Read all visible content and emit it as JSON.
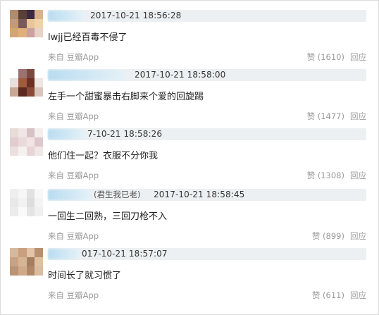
{
  "comments": [
    {
      "name_suffix": "",
      "date": "2017-10-21 18:56:28",
      "text": "lwjj已经百毒不侵了",
      "source": "来自 豆瓣App",
      "like_label": "赞 (1610)",
      "reply_label": "回应",
      "avatar_colors": [
        "#b08c6e",
        "#5a4038",
        "#3c2a40",
        "#d9b28c",
        "#c69a78",
        "#7a5a58",
        "#e8c59a",
        "#f0d2a8",
        "#d4a572",
        "#e0b07a",
        "#caa0a0",
        "#e8d2c6"
      ]
    },
    {
      "name_suffix": "",
      "date": "2017-10-21 18:58:00",
      "text": "左手一个甜蜜暴击右脚来个爱的回旋踢",
      "source": "来自 豆瓣App",
      "like_label": "赞 (1477)",
      "reply_label": "回应",
      "avatar_colors": [
        "#ffffff",
        "#9c7270",
        "#7a4a40",
        "#ffffff",
        "#e8e0dc",
        "#a05a3c",
        "#6a3024",
        "#efe6e2",
        "#c8a894",
        "#5a2a22",
        "#8a4a38",
        "#d8c6bc"
      ]
    },
    {
      "name_suffix": "",
      "date": "7-10-21 18:58:26",
      "text": "他们住一起？衣服不分你我",
      "source": "来自 豆瓣App",
      "like_label": "赞 (1308)",
      "reply_label": "回应",
      "avatar_colors": [
        "#e8dcd8",
        "#f0e6e6",
        "#d6c2c6",
        "#f4eeee",
        "#e2ccd0",
        "#eadada",
        "#f2e4e4",
        "#dcc8cc",
        "#ece0de",
        "#f6f0ee",
        "#e6d4d6",
        "#f0e8e6"
      ]
    },
    {
      "name_suffix": "(君生我已老)",
      "date": "2017-10-21 18:58:45",
      "text": "一回生二回熟，三回刀枪不入",
      "source": "来自 豆瓣App",
      "like_label": "赞 (899)",
      "reply_label": "回应",
      "avatar_colors": [
        "#eeeeee",
        "#f6f6f6",
        "#e2e2e2",
        "#f8f8f8",
        "#e8e8e8",
        "#f2f2f2",
        "#dddddd",
        "#f4f4f4",
        "#ececec",
        "#fafafa",
        "#e4e4e4",
        "#f0f0f0"
      ]
    },
    {
      "name_suffix": "",
      "date": "017-10-21 18:57:07",
      "text": "时间长了就习惯了",
      "source": "来自 豆瓣App",
      "like_label": "赞 (611)",
      "reply_label": "回应",
      "avatar_colors": [
        "#d8b89a",
        "#c8a080",
        "#e2c4a6",
        "#b89070",
        "#caa282",
        "#d6b496",
        "#a47e60",
        "#e0c0a0",
        "#bc9474",
        "#ceaa8a",
        "#b08868",
        "#dabc9e"
      ]
    }
  ]
}
